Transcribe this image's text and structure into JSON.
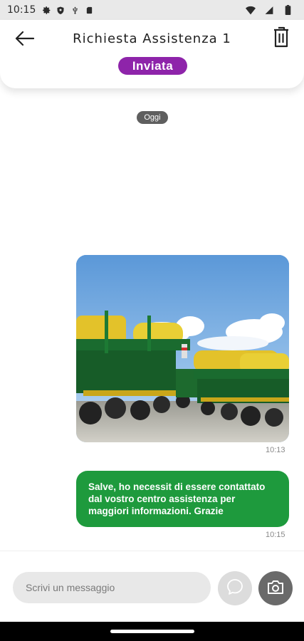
{
  "status_bar": {
    "time": "10:15",
    "left_icons": [
      "gear-icon",
      "shield-icon",
      "usb-icon",
      "sd-card-icon"
    ],
    "right_icons": [
      "wifi-icon",
      "signal-icon",
      "battery-icon"
    ]
  },
  "header": {
    "title": "Richiesta Assistenza 1",
    "status": "Inviata",
    "status_color": "#8e24aa",
    "back_icon": "arrow-left-icon",
    "delete_icon": "trash-icon"
  },
  "chat": {
    "date_label": "Oggi",
    "messages": [
      {
        "type": "image",
        "alt": "",
        "time": "10:13"
      },
      {
        "type": "text",
        "text": "Salve, ho necessit di essere contattato dal vostro centro assistenza per maggiori informazioni. Grazie",
        "time": "10:15",
        "bubble_color": "#1e9a3d"
      }
    ]
  },
  "composer": {
    "placeholder": "Scrivi un messaggio",
    "value": "",
    "send_icon": "chat-bubble-icon",
    "camera_icon": "camera-icon"
  }
}
